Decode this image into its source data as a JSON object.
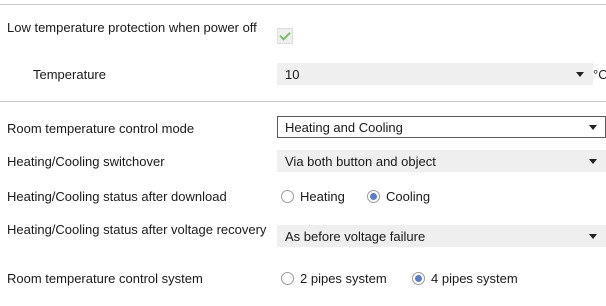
{
  "low_temp": {
    "label": "Low temperature protection when power off",
    "checked": true
  },
  "temperature": {
    "label": "Temperature",
    "value": "10",
    "unit": "°C"
  },
  "control_mode": {
    "label": "Room temperature control mode",
    "value": "Heating and Cooling"
  },
  "switchover": {
    "label": "Heating/Cooling switchover",
    "value": "Via both button and object"
  },
  "status_after_download": {
    "label": "Heating/Cooling status after download",
    "options": [
      "Heating",
      "Cooling"
    ],
    "selected": "Cooling"
  },
  "status_after_recovery": {
    "label": "Heating/Cooling status after voltage recovery",
    "value": "As before voltage failure"
  },
  "control_system": {
    "label": "Room temperature control system",
    "options": [
      "2 pipes system",
      "4 pipes system"
    ],
    "selected": "4 pipes system"
  },
  "colors": {
    "accent": "#5c7fbf",
    "check": "#7fbf6a",
    "field_bg": "#efefef",
    "divider": "#c9c9c9"
  }
}
